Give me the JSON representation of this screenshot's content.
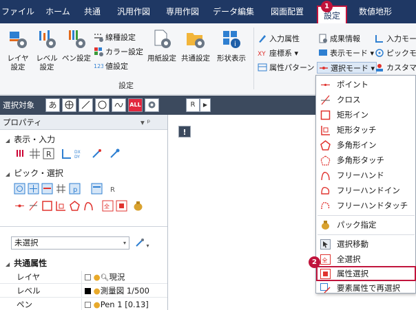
{
  "menu": {
    "items": [
      "ファイル",
      "ホーム",
      "共通",
      "汎用作図",
      "専用作図",
      "データ編集",
      "図面配置",
      "設定",
      "数値地形"
    ],
    "active_index": 7
  },
  "ribbon": {
    "buttons": {
      "layer": "レイヤ\n設定",
      "level": "レベル\n設定",
      "pen": "ペン設定",
      "paper": "用紙設定",
      "common": "共通設定",
      "shape": "形状表示"
    },
    "small": {
      "line_type": "線種設定",
      "color": "カラー設定",
      "value": "値設定",
      "input_attr": "入力属性",
      "coord": "座標系",
      "attr_pattern": "属性パターン",
      "result_info": "成果情報",
      "display_mode": "表示モード",
      "select_mode": "選択モード",
      "input_mode": "入力モー",
      "pick_mode": "ピックモー",
      "custom": "カスタマイ"
    },
    "group_label": "設定"
  },
  "seltoolbar": {
    "label": "選択対象",
    "btn_text": "あ",
    "all_label": "ALL",
    "r_label": "R"
  },
  "panel": {
    "title": "プロパティ",
    "pin": "▾ ᵖ",
    "section_display": "表示・入力",
    "section_pick": "ピック・選択",
    "select_value": "未選択",
    "common_attr": "共通属性",
    "rows": [
      {
        "key": "レイヤ",
        "value": "現況"
      },
      {
        "key": "レベル",
        "value": "測量図 1/500"
      },
      {
        "key": "ペン",
        "value": "Pen 1 [0.13]"
      }
    ]
  },
  "dropdown": {
    "items": [
      {
        "label": "ポイント",
        "icon": "point-icon"
      },
      {
        "label": "クロス",
        "icon": "cross-icon"
      },
      {
        "label": "矩形イン",
        "icon": "rect-in-icon"
      },
      {
        "label": "矩形タッチ",
        "icon": "rect-touch-icon"
      },
      {
        "label": "多角形イン",
        "icon": "polygon-in-icon"
      },
      {
        "label": "多角形タッチ",
        "icon": "polygon-touch-icon"
      },
      {
        "label": "フリーハンド",
        "icon": "freehand-icon"
      },
      {
        "label": "フリーハンドイン",
        "icon": "freehand-in-icon"
      },
      {
        "label": "フリーハンドタッチ",
        "icon": "freehand-touch-icon"
      },
      {
        "label": "パック指定",
        "icon": "pack-icon"
      },
      {
        "label": "選択移動",
        "icon": "select-move-icon"
      },
      {
        "label": "全選択",
        "icon": "select-all-icon"
      },
      {
        "label": "属性選択",
        "icon": "attribute-select-icon"
      },
      {
        "label": "要素属性で再選択",
        "icon": "reselect-icon"
      }
    ]
  },
  "badges": {
    "one": "1",
    "two": "2"
  },
  "canvas": {
    "marker": "!"
  },
  "colors": {
    "menubar": "#1f3864",
    "accent": "#c0143c",
    "toolbar": "#3c4a5e"
  }
}
